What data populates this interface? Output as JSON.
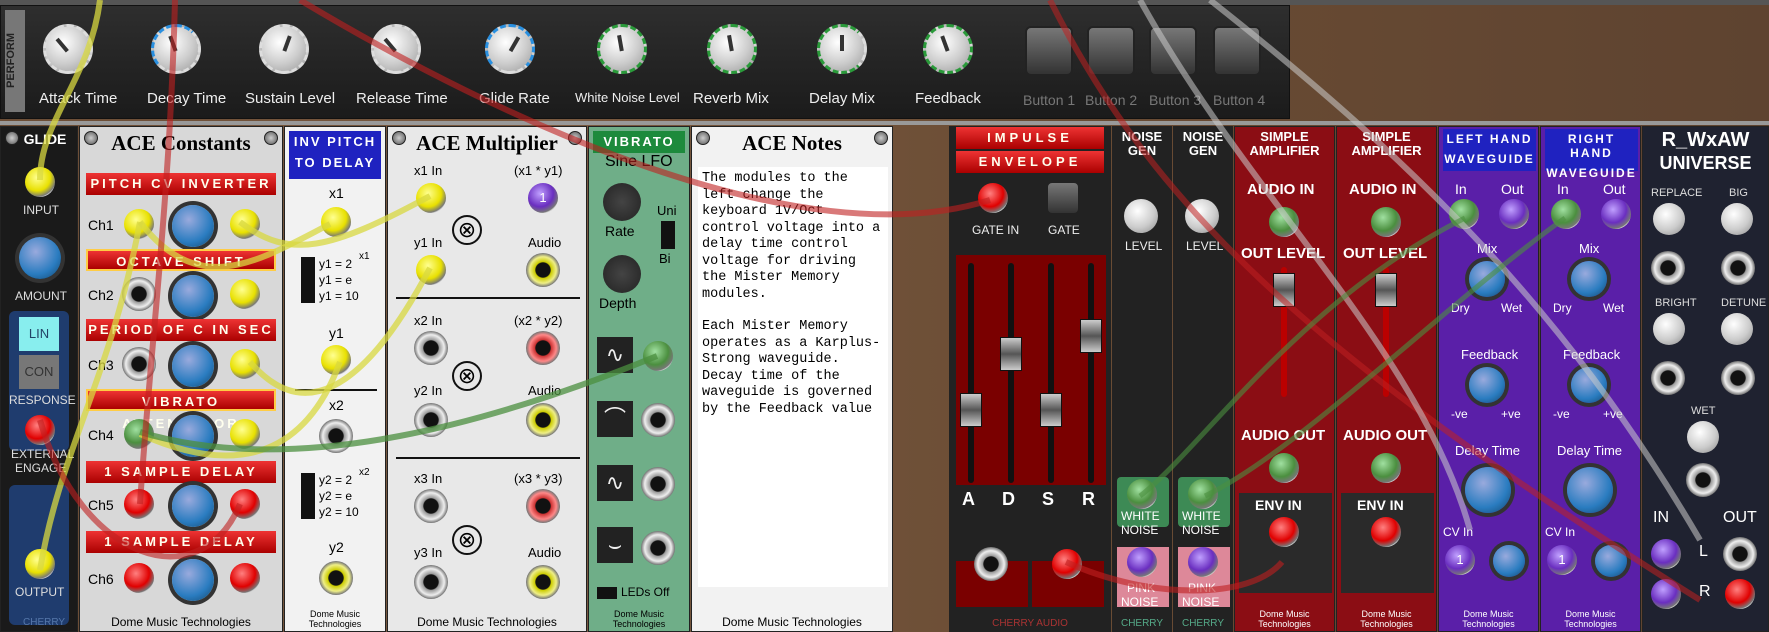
{
  "perform": {
    "tab_label": "PERFORM",
    "knobs": [
      {
        "label": "Attack Time"
      },
      {
        "label": "Decay Time"
      },
      {
        "label": "Sustain Level"
      },
      {
        "label": "Release Time"
      },
      {
        "label": "Glide Rate"
      },
      {
        "label": "White Noise Level"
      },
      {
        "label": "Reverb Mix"
      },
      {
        "label": "Delay Mix"
      },
      {
        "label": "Feedback"
      }
    ],
    "buttons": [
      "Button 1",
      "Button 2",
      "Button 3",
      "Button 4"
    ]
  },
  "glide": {
    "title": "GLIDE",
    "input": "INPUT",
    "amount": "AMOUNT",
    "lin": "LIN",
    "con": "CON",
    "response": "RESPONSE",
    "external": "EXTERNAL",
    "engage": "ENGAGE",
    "output": "OUTPUT",
    "brand": "CHERRY"
  },
  "constants": {
    "title": "ACE Constants",
    "banners": [
      "PITCH CV INVERTER",
      "OCTAVE SHIFT",
      "PERIOD OF C IN SEC",
      "VIBRATO ATTENUATOR",
      "1 SAMPLE DELAY",
      "1 SAMPLE DELAY"
    ],
    "channels": [
      "Ch1",
      "Ch2",
      "Ch3",
      "Ch4",
      "Ch5",
      "Ch6"
    ],
    "footer": "Dome Music Technologies"
  },
  "inv": {
    "title1": "INV PITCH",
    "title2": "TO DELAY",
    "x1": "x1",
    "y1": "y1",
    "x2": "x2",
    "y2": "y2",
    "f1a": "y1 = 2",
    "f1b": "y1 = e",
    "f1c": "y1 = 10",
    "f2a": "y2 = 2",
    "f2b": "y2 = e",
    "f2c": "y2 = 10",
    "sup1": "x1",
    "sup2": "x2",
    "footer1": "Dome Music",
    "footer2": "Technologies"
  },
  "mult": {
    "title": "ACE Multiplier",
    "rows": [
      {
        "in_x": "x1 In",
        "in_y": "y1 In",
        "prod": "(x1 * y1)",
        "audio": "Audio"
      },
      {
        "in_x": "x2 In",
        "in_y": "y2 In",
        "prod": "(x2 * y2)",
        "audio": "Audio"
      },
      {
        "in_x": "x3 In",
        "in_y": "y3 In",
        "prod": "(x3 * y3)",
        "audio": "Audio"
      }
    ],
    "badge": "1",
    "footer": "Dome Music Technologies"
  },
  "vibrato": {
    "title": "VIBRATO",
    "sub": "Sine LFO",
    "rate": "Rate",
    "uni": "Uni",
    "bi": "Bi",
    "depth": "Depth",
    "leds": "LEDs Off",
    "footer1": "Dome Music",
    "footer2": "Technologies"
  },
  "notes": {
    "title": "ACE Notes",
    "para1": "The modules to the left change the keyboard 1V/Oct control voltage into a delay time control voltage for driving the Mister Memory modules.",
    "para2": "Each Mister Memory operates as a Karplus-Strong waveguide. Decay time of the waveguide is governed by the Feedback value",
    "footer": "Dome Music Technologies"
  },
  "impulse": {
    "title1": "IMPULSE",
    "title2": "ENVELOPE",
    "gate_in": "GATE IN",
    "gate": "GATE",
    "adsr": [
      "A",
      "D",
      "S",
      "R"
    ],
    "adsr_levels": [
      0.3,
      0.6,
      0.3,
      0.7
    ],
    "brand": "CHERRY AUDIO"
  },
  "noise1": {
    "title1": "NOISE",
    "title2": "GEN",
    "level": "LEVEL",
    "white1": "WHITE",
    "white2": "NOISE",
    "pink1": "PINK",
    "pink2": "NOISE",
    "brand": "CHERRY"
  },
  "noise2": {
    "title1": "NOISE",
    "title2": "GEN",
    "level": "LEVEL",
    "white1": "WHITE",
    "white2": "NOISE",
    "pink1": "PINK",
    "pink2": "NOISE",
    "brand": "CHERRY"
  },
  "amp1": {
    "title1": "SIMPLE",
    "title2": "AMPLIFIER",
    "audio_in": "AUDIO IN",
    "out_level": "OUT LEVEL",
    "audio_out": "AUDIO OUT",
    "env_in": "ENV IN",
    "footer1": "Dome Music",
    "footer2": "Technologies"
  },
  "amp2": {
    "title1": "SIMPLE",
    "title2": "AMPLIFIER",
    "audio_in": "AUDIO IN",
    "out_level": "OUT LEVEL",
    "audio_out": "AUDIO OUT",
    "env_in": "ENV IN",
    "footer1": "Dome Music",
    "footer2": "Technologies"
  },
  "wg1": {
    "title1": "LEFT HAND",
    "title2": "WAVEGUIDE",
    "in": "In",
    "out": "Out",
    "mix": "Mix",
    "dry": "Dry",
    "wet": "Wet",
    "feedback": "Feedback",
    "neg": "-ve",
    "pos": "+ve",
    "delay": "Delay Time",
    "cv": "CV In",
    "badge": "1",
    "footer1": "Dome Music",
    "footer2": "Technologies"
  },
  "wg2": {
    "title1": "RIGHT HAND",
    "title2": "WAVEGUIDE",
    "in": "In",
    "out": "Out",
    "mix": "Mix",
    "dry": "Dry",
    "wet": "Wet",
    "feedback": "Feedback",
    "neg": "-ve",
    "pos": "+ve",
    "delay": "Delay Time",
    "cv": "CV In",
    "badge": "1",
    "footer1": "Dome Music",
    "footer2": "Technologies"
  },
  "universe": {
    "title1": "R_WxAW",
    "title2": "UNIVERSE",
    "replace": "REPLACE",
    "big": "BIG",
    "bright": "BRIGHT",
    "detune": "DETUNE",
    "wet": "WET",
    "in": "IN",
    "out": "OUT",
    "l": "L",
    "r": "R"
  },
  "colors": {
    "panel_red": "#b00000",
    "waveguide_purple": "#5a1fa8",
    "vibrato_green": "#6fae88",
    "cable_yellow": "#d8d840",
    "cable_red": "#c02020"
  }
}
